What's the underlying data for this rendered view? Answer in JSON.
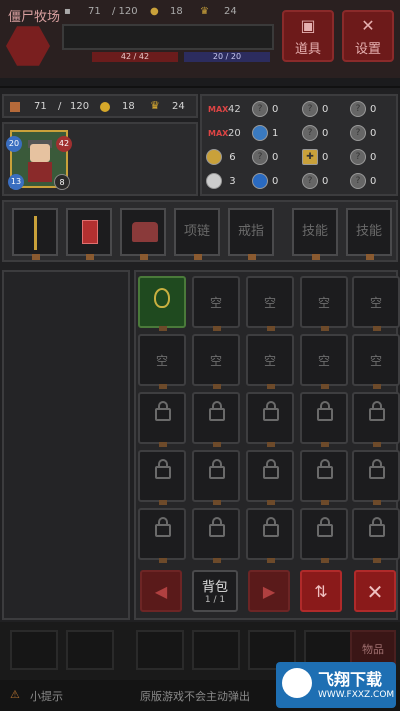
{
  "hud": {
    "map_name": "僵尸牧场",
    "shoes": "71",
    "shoes_max": "/ 120",
    "coins": "18",
    "crowns": "24",
    "hp_text": "42 / 42",
    "mp_text": "20 / 20",
    "items_button": "道具",
    "settings_button": "设置"
  },
  "stats": {
    "shoes": "71",
    "shoes_sep": "/",
    "shoes_max": "120",
    "coins": "18",
    "crowns": "24"
  },
  "character": {
    "level": "20",
    "hp": "42",
    "badge_left": "13",
    "badge_right": "8"
  },
  "resources": [
    {
      "label": "MAX",
      "value": "42",
      "cells": [
        "0",
        "0",
        "0"
      ]
    },
    {
      "label": "MAX",
      "value": "20",
      "cells": [
        "1",
        "0",
        "0"
      ]
    },
    {
      "label": "",
      "value": "6",
      "cells": [
        "0",
        "0",
        "0"
      ]
    },
    {
      "label": "",
      "value": "3",
      "cells": [
        "0",
        "0",
        "0"
      ]
    }
  ],
  "equipment": {
    "slots": [
      "",
      "",
      "",
      "项链",
      "戒指",
      "技能",
      "技能"
    ]
  },
  "bag": {
    "empty_label": "空",
    "page_title": "背包",
    "page_num": "1 / 1",
    "prev": "◀",
    "next": "▶",
    "sort": "⇅",
    "close": "✕"
  },
  "bottom": {
    "slots": [
      "",
      "",
      "",
      "",
      "",
      "",
      "物品"
    ],
    "tip_icon": "⚠",
    "tip_title": "小提示",
    "tip_text": "原版游戏不会主动弹出"
  },
  "watermark": {
    "title": "飞翔下载",
    "url": "WWW.FXXZ.COM"
  },
  "colors": {
    "accent_red": "#8a1a1a",
    "panel_bg": "#202022",
    "item_green": "#1f4a1f"
  }
}
